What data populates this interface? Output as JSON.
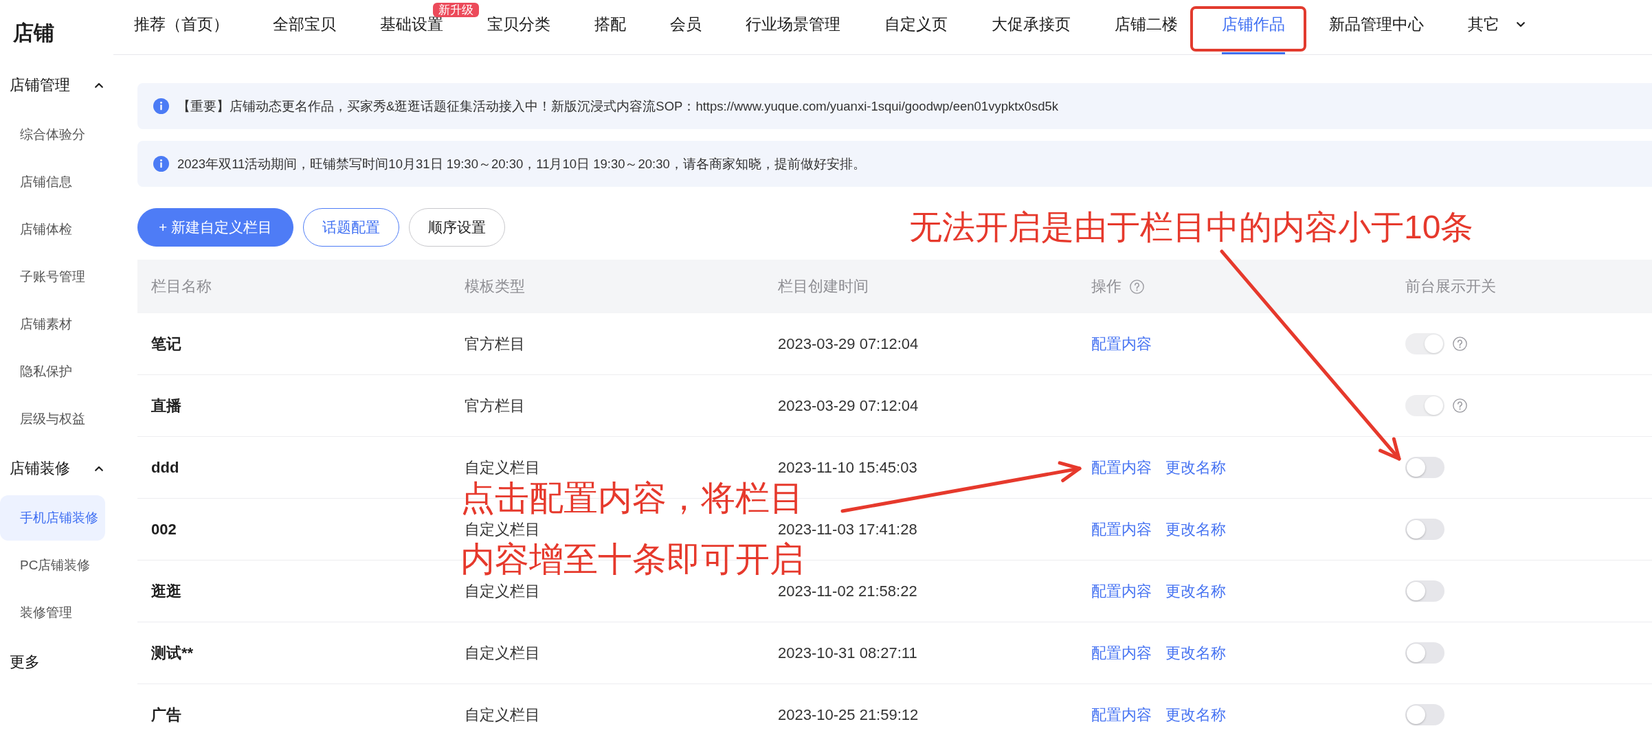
{
  "brand": {
    "title": "店铺"
  },
  "nav": {
    "tabs": [
      {
        "label": "推荐（首页）",
        "kind": "tab",
        "selected": false,
        "highlighted": false
      },
      {
        "label": "全部宝贝",
        "kind": "tab",
        "selected": false,
        "highlighted": false
      },
      {
        "label": "基础设置",
        "kind": "tab",
        "selected": false,
        "highlighted": false,
        "badge": "新升级"
      },
      {
        "label": "宝贝分类",
        "kind": "tab",
        "selected": false,
        "highlighted": false
      },
      {
        "label": "搭配",
        "kind": "tab",
        "selected": false,
        "highlighted": false
      },
      {
        "label": "会员",
        "kind": "tab",
        "selected": false,
        "highlighted": false
      },
      {
        "label": "行业场景管理",
        "kind": "tab",
        "selected": false,
        "highlighted": false
      },
      {
        "label": "自定义页",
        "kind": "tab",
        "selected": false,
        "highlighted": false
      },
      {
        "label": "大促承接页",
        "kind": "tab",
        "selected": false,
        "highlighted": false
      },
      {
        "label": "店铺二楼",
        "kind": "tab",
        "selected": false,
        "highlighted": false
      },
      {
        "label": "店铺作品",
        "kind": "tab",
        "selected": true,
        "highlighted": true
      },
      {
        "label": "新品管理中心",
        "kind": "tab",
        "selected": false,
        "highlighted": false
      },
      {
        "label": "其它",
        "kind": "dropdown",
        "selected": false,
        "highlighted": false
      }
    ]
  },
  "sidebar": {
    "groups": [
      {
        "title": "店铺管理",
        "expanded": true,
        "items": [
          {
            "label": "综合体验分",
            "selected": false
          },
          {
            "label": "店铺信息",
            "selected": false
          },
          {
            "label": "店铺体检",
            "selected": false
          },
          {
            "label": "子账号管理",
            "selected": false
          },
          {
            "label": "店铺素材",
            "selected": false
          },
          {
            "label": "隐私保护",
            "selected": false
          },
          {
            "label": "层级与权益",
            "selected": false
          }
        ]
      },
      {
        "title": "店铺装修",
        "expanded": true,
        "items": [
          {
            "label": "手机店铺装修",
            "selected": true
          },
          {
            "label": "PC店铺装修",
            "selected": false
          },
          {
            "label": "装修管理",
            "selected": false
          }
        ]
      },
      {
        "title": "更多"
      }
    ]
  },
  "notices": [
    {
      "text": "【重要】店铺动态更名作品，买家秀&逛逛话题征集活动接入中！新版沉浸式内容流SOP：https://www.yuque.com/yuanxi-1squi/goodwp/een01vypktx0sd5k"
    },
    {
      "text": "2023年双11活动期间，旺铺禁写时间10月31日 19:30～20:30，11月10日 19:30～20:30，请各商家知晓，提前做好安排。"
    }
  ],
  "actions": [
    {
      "label": "+ 新建自定义栏目",
      "kind": "primary"
    },
    {
      "label": "话题配置",
      "kind": "outline"
    },
    {
      "label": "顺序设置",
      "kind": "default"
    }
  ],
  "table": {
    "columns": [
      {
        "label": "栏目名称"
      },
      {
        "label": "模板类型"
      },
      {
        "label": "栏目创建时间"
      },
      {
        "label": "操作",
        "help": true
      },
      {
        "label": "前台展示开关"
      }
    ],
    "rows": [
      {
        "name": "笔记",
        "template": "官方栏目",
        "created": "2023-03-29 07:12:04",
        "actions": [
          "配置内容"
        ],
        "switch": {
          "on": true,
          "disabled": true,
          "help": true
        }
      },
      {
        "name": "直播",
        "template": "官方栏目",
        "created": "2023-03-29 07:12:04",
        "switch": {
          "on": true,
          "disabled": true,
          "help": true
        }
      },
      {
        "name": "ddd",
        "template": "自定义栏目",
        "created": "2023-11-10 15:45:03",
        "actions": [
          "配置内容",
          "更改名称"
        ],
        "switch": {
          "on": false,
          "disabled": false,
          "help": false
        }
      },
      {
        "name": "002",
        "template": "自定义栏目",
        "created": "2023-11-03 17:41:28",
        "actions": [
          "配置内容",
          "更改名称"
        ],
        "switch": {
          "on": false,
          "disabled": false,
          "help": false
        }
      },
      {
        "name": "逛逛",
        "template": "自定义栏目",
        "created": "2023-11-02 21:58:22",
        "actions": [
          "配置内容",
          "更改名称"
        ],
        "switch": {
          "on": false,
          "disabled": false,
          "help": false
        }
      },
      {
        "name": "测试**",
        "template": "自定义栏目",
        "created": "2023-10-31 08:27:11",
        "actions": [
          "配置内容",
          "更改名称"
        ],
        "switch": {
          "on": false,
          "disabled": false,
          "help": false
        }
      },
      {
        "name": "广告",
        "template": "自定义栏目",
        "created": "2023-10-25 21:59:12",
        "actions": [
          "配置内容",
          "更改名称"
        ],
        "switch": {
          "on": false,
          "disabled": false,
          "help": false
        }
      }
    ]
  },
  "annotations": [
    {
      "kind": "callout",
      "lines": [
        "无法开启是由于栏目中的内容小于10条"
      ]
    },
    {
      "kind": "callout",
      "lines": [
        "点击配置内容，将栏目",
        "内容增至十条即可开启"
      ]
    }
  ]
}
